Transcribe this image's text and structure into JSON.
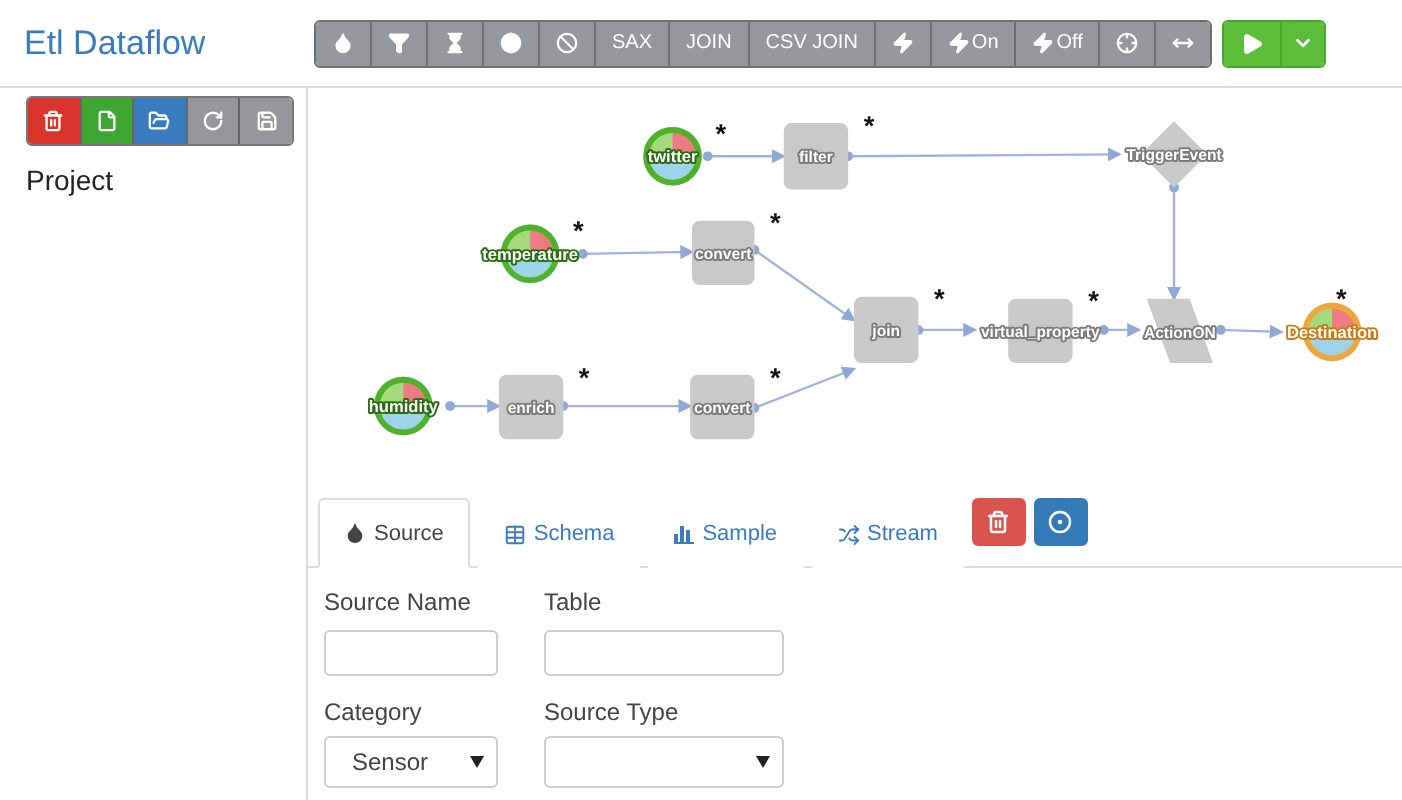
{
  "app": {
    "title": "Etl Dataflow"
  },
  "toolbar": [
    {
      "kind": "icon"
    },
    {
      "kind": "icon"
    },
    {
      "kind": "icon"
    },
    {
      "kind": "icon"
    },
    {
      "kind": "icon"
    },
    {
      "kind": "text",
      "label": "SAX"
    },
    {
      "kind": "text",
      "label": "JOIN"
    },
    {
      "kind": "text",
      "label": "CSV JOIN"
    },
    {
      "kind": "icon"
    },
    {
      "kind": "icon_text",
      "label": "On"
    },
    {
      "kind": "icon_text",
      "label": "Off"
    },
    {
      "kind": "icon"
    },
    {
      "kind": "icon"
    }
  ],
  "sidebar": {
    "buttons": [
      {
        "color": "#d9342b"
      },
      {
        "color": "#3fa633"
      },
      {
        "color": "#3a7bc0"
      },
      {
        "color": "#96979b"
      },
      {
        "color": "#96979b"
      }
    ],
    "heading": "Project"
  },
  "nodes": [
    {
      "kind": "source",
      "label": "twitter",
      "badge": "*"
    },
    {
      "kind": "process",
      "label": "filter",
      "badge": "*"
    },
    {
      "kind": "trigger",
      "label": "TriggerEvent"
    },
    {
      "kind": "source",
      "label": "temperature",
      "badge": "*"
    },
    {
      "kind": "process",
      "label": "convert",
      "badge": "*"
    },
    {
      "kind": "process",
      "label": "join",
      "badge": "*"
    },
    {
      "kind": "process",
      "label": "virtual_property",
      "badge": "*"
    },
    {
      "kind": "action",
      "label": "ActionON"
    },
    {
      "kind": "destination",
      "label": "Destination",
      "badge": "*"
    },
    {
      "kind": "source",
      "label": "humidity"
    },
    {
      "kind": "process",
      "label": "enrich",
      "badge": "*"
    },
    {
      "kind": "process",
      "label": "convert",
      "badge": "*"
    }
  ],
  "tabs": [
    {
      "label": "Source",
      "selected": true
    },
    {
      "label": "Schema",
      "selected": false
    },
    {
      "label": "Sample",
      "selected": false
    },
    {
      "label": "Stream",
      "selected": false
    }
  ],
  "form": {
    "source_name": {
      "label": "Source Name"
    },
    "table": {
      "label": "Table"
    },
    "category": {
      "label": "Category",
      "value": "Sensor"
    },
    "source_type": {
      "label": "Source Type"
    }
  }
}
